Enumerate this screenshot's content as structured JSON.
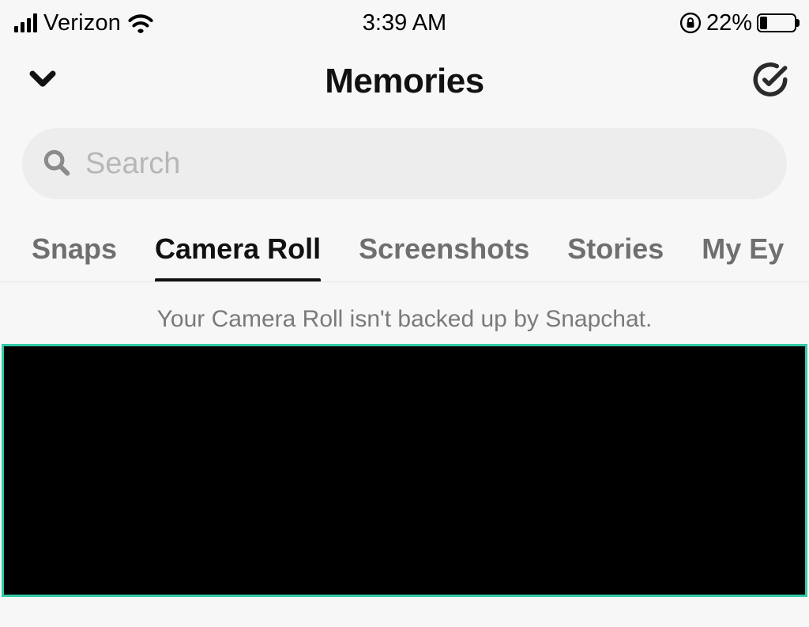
{
  "status": {
    "carrier": "Verizon",
    "time": "3:39 AM",
    "battery_pct": "22%",
    "battery_fill_pct": 22
  },
  "header": {
    "title": "Memories"
  },
  "search": {
    "placeholder": "Search"
  },
  "tabs": {
    "items": [
      {
        "label": "Snaps",
        "active": false
      },
      {
        "label": "Camera Roll",
        "active": true
      },
      {
        "label": "Screenshots",
        "active": false
      },
      {
        "label": "Stories",
        "active": false
      },
      {
        "label": "My Ey",
        "active": false
      }
    ]
  },
  "content": {
    "backup_notice": "Your Camera Roll isn't backed up by Snapchat."
  },
  "colors": {
    "selection_border": "#34c9a8"
  }
}
